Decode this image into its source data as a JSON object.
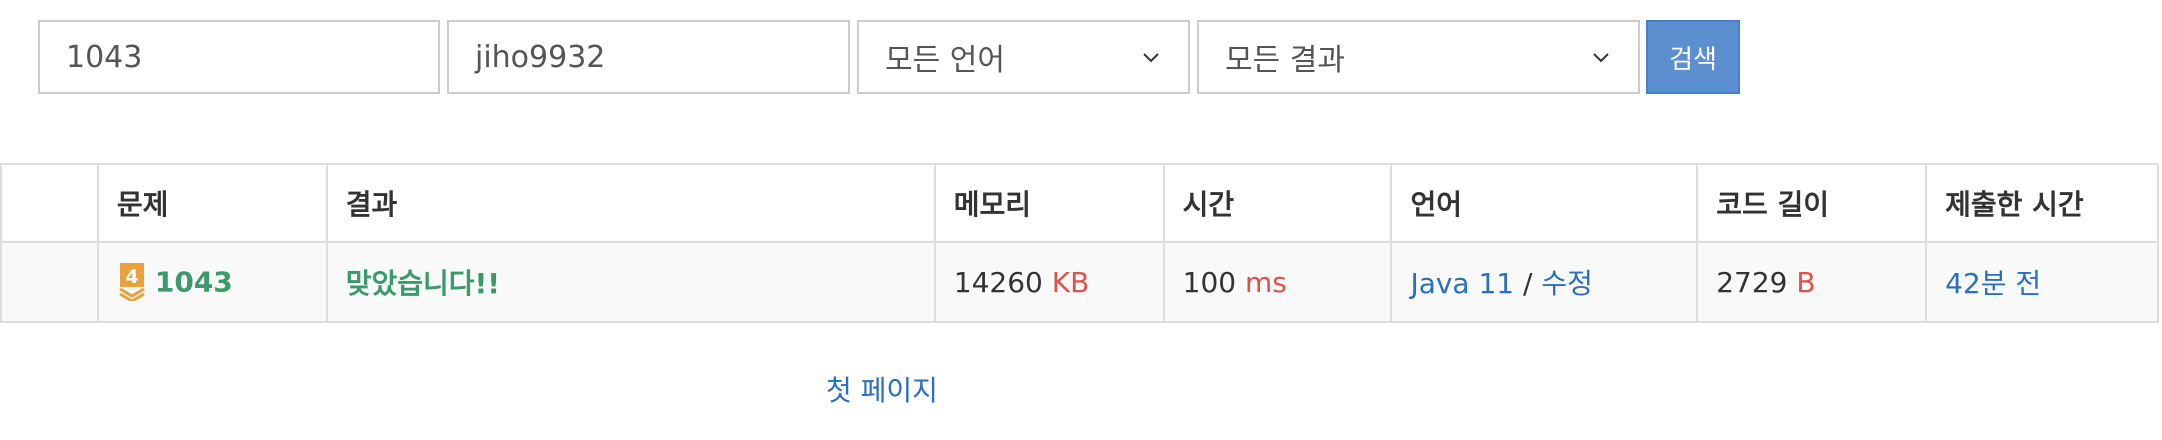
{
  "search": {
    "problem_value": "1043",
    "user_value": "jiho9932",
    "language_selected": "모든 언어",
    "result_selected": "모든 결과",
    "button_label": "검색"
  },
  "table": {
    "headers": [
      "문제",
      "결과",
      "메모리",
      "시간",
      "언어",
      "코드 길이",
      "제출한 시간"
    ],
    "rows": [
      {
        "tier_number": "4",
        "problem": "1043",
        "result": "맞았습니다!!",
        "memory": "14260",
        "memory_unit": "KB",
        "time": "100",
        "time_unit": "ms",
        "language": "Java 11",
        "separator": "/",
        "edit": "수정",
        "code_length": "2729",
        "code_length_unit": "B",
        "submitted": "42분 전"
      }
    ]
  },
  "pagination": {
    "first_page": "첫 페이지"
  },
  "colors": {
    "accepted": "#3a9a6b",
    "unit": "#d9534f",
    "link": "#2a6fbd",
    "search_button": "#5b8fd0",
    "tier_badge": "#e9a23b"
  },
  "icons": {
    "tier": "gold-tier-badge-icon",
    "dropdown": "chevron-down-icon"
  }
}
